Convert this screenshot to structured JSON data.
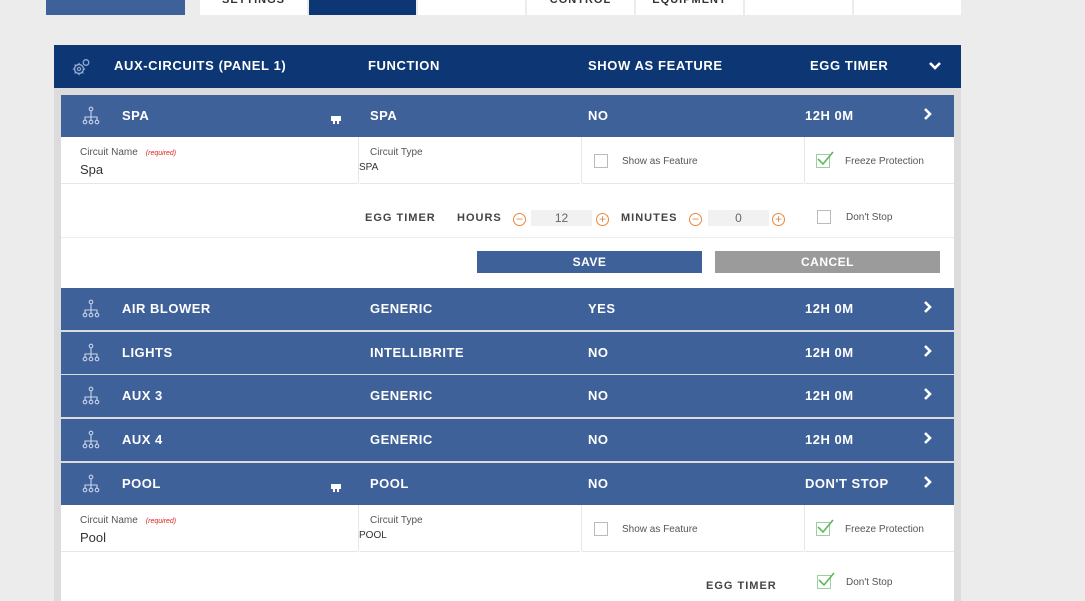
{
  "tabs": [
    {
      "label": ""
    },
    {
      "label": "SETTINGS"
    },
    {
      "label": ""
    },
    {
      "label": ""
    },
    {
      "label": "CONTROL"
    },
    {
      "label": "EQUIPMENT"
    },
    {
      "label": ""
    },
    {
      "label": ""
    }
  ],
  "header": {
    "title": "AUX-CIRCUITS (PANEL 1)",
    "function": "FUNCTION",
    "show_as_feature": "SHOW AS FEATURE",
    "egg_timer": "EGG TIMER"
  },
  "circuits": [
    {
      "name": "SPA",
      "function": "SPA",
      "feature": "NO",
      "timer": "12H 0M"
    },
    {
      "name": "AIR BLOWER",
      "function": "GENERIC",
      "feature": "YES",
      "timer": "12H 0M"
    },
    {
      "name": "LIGHTS",
      "function": "INTELLIBRITE",
      "feature": "NO",
      "timer": "12H 0M"
    },
    {
      "name": "AUX 3",
      "function": "GENERIC",
      "feature": "NO",
      "timer": "12H 0M"
    },
    {
      "name": "AUX 4",
      "function": "GENERIC",
      "feature": "NO",
      "timer": "12H 0M"
    },
    {
      "name": "POOL",
      "function": "POOL",
      "feature": "NO",
      "timer": "DON'T STOP"
    }
  ],
  "spa_detail": {
    "circuit_name_label": "Circuit Name",
    "required": "(required)",
    "circuit_name_value": "Spa",
    "circuit_type_label": "Circuit Type",
    "circuit_type_value": "SPA",
    "show_feature_label": "Show as Feature",
    "show_feature_checked": false,
    "freeze_label": "Freeze Protection",
    "freeze_checked": true,
    "egg_timer_label": "EGG TIMER",
    "hours_label": "HOURS",
    "hours_value": "12",
    "minutes_label": "MINUTES",
    "minutes_value": "0",
    "dont_stop_label": "Don't Stop",
    "dont_stop_checked": false,
    "save_label": "SAVE",
    "cancel_label": "CANCEL"
  },
  "pool_detail": {
    "circuit_name_label": "Circuit Name",
    "required": "(required)",
    "circuit_name_value": "Pool",
    "circuit_type_label": "Circuit Type",
    "circuit_type_value": "POOL",
    "show_feature_label": "Show as Feature",
    "show_feature_checked": false,
    "freeze_label": "Freeze Protection",
    "freeze_checked": true,
    "egg_timer_label": "EGG TIMER",
    "dont_stop_label": "Don't Stop",
    "dont_stop_checked": true
  },
  "icons": {
    "header": "gear-icon",
    "row": "circuit-tree-icon",
    "flag": "flag-icon",
    "chevron": "chevron-right-icon",
    "collapse": "chevron-down-icon",
    "minus": "minus-circle-icon",
    "plus": "plus-circle-icon",
    "check": "check-icon"
  },
  "colors": {
    "header_bg": "#0d3674",
    "row_bg": "#3f6199",
    "accent_orange": "#e8873e",
    "check_green": "#5cb85c",
    "cancel_bg": "#9b9b9b"
  }
}
